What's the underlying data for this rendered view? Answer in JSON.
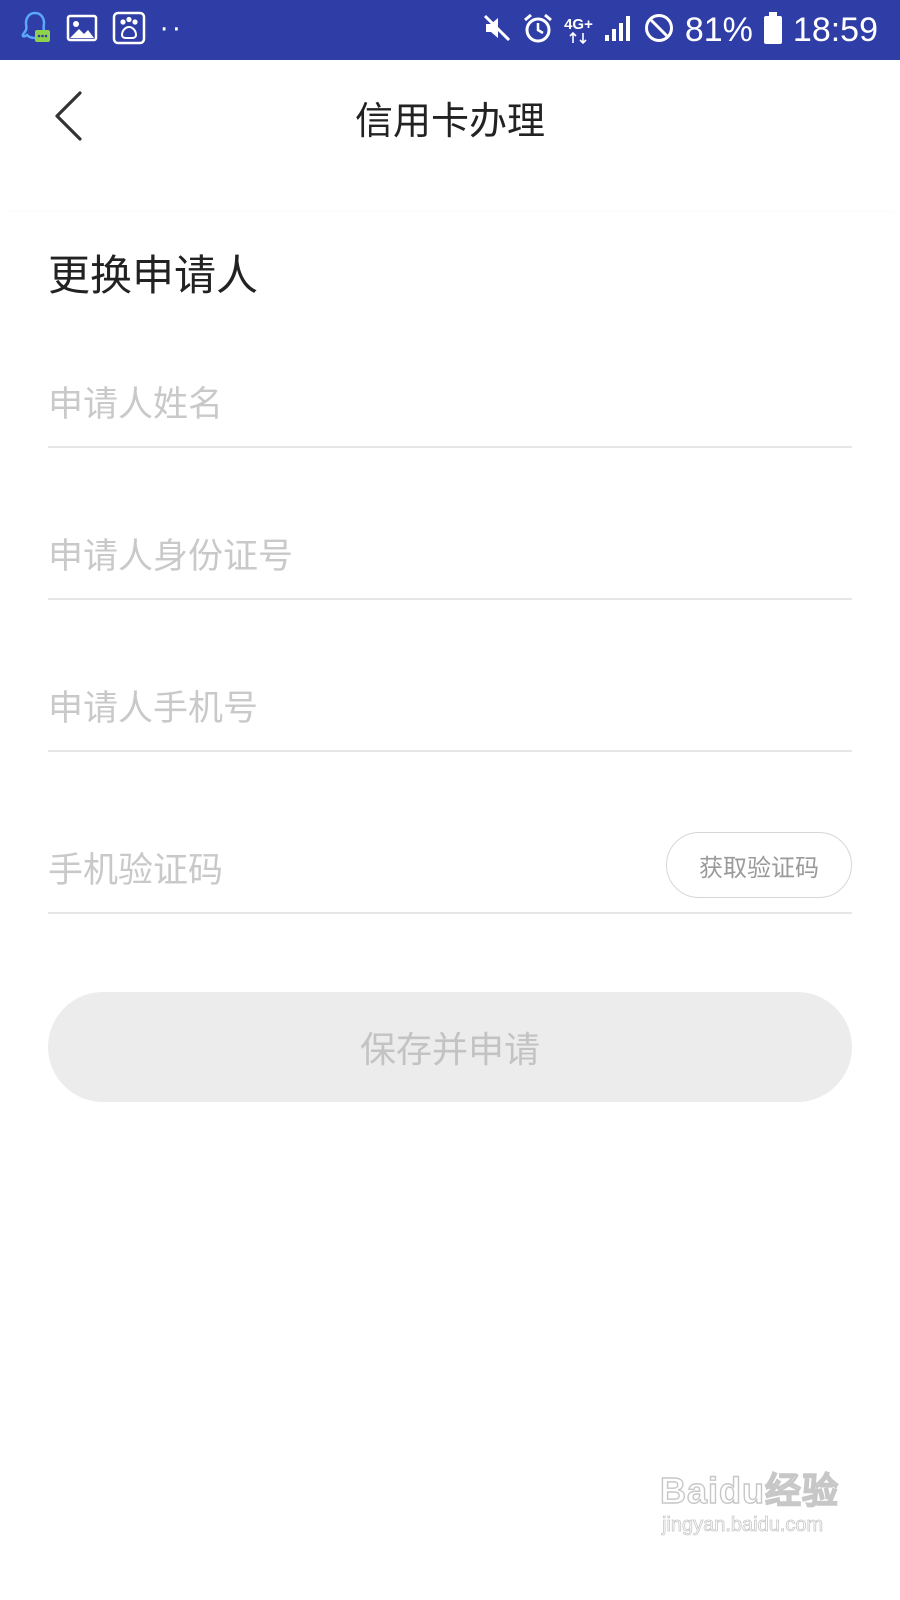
{
  "status_bar": {
    "battery": "81%",
    "time": "18:59",
    "network": "4G+",
    "dots": "··"
  },
  "nav": {
    "title": "信用卡办理"
  },
  "form": {
    "section_title": "更换申请人",
    "name_placeholder": "申请人姓名",
    "id_placeholder": "申请人身份证号",
    "phone_placeholder": "申请人手机号",
    "code_placeholder": "手机验证码",
    "get_code_label": "获取验证码",
    "submit_label": "保存并申请"
  },
  "watermark": {
    "logo_text": "Baidu经验",
    "url": "jingyan.baidu.com"
  },
  "colors": {
    "status_bar": "#2f3ea6",
    "placeholder": "#c9c9c9",
    "submit_disabled_bg": "#ececec"
  }
}
